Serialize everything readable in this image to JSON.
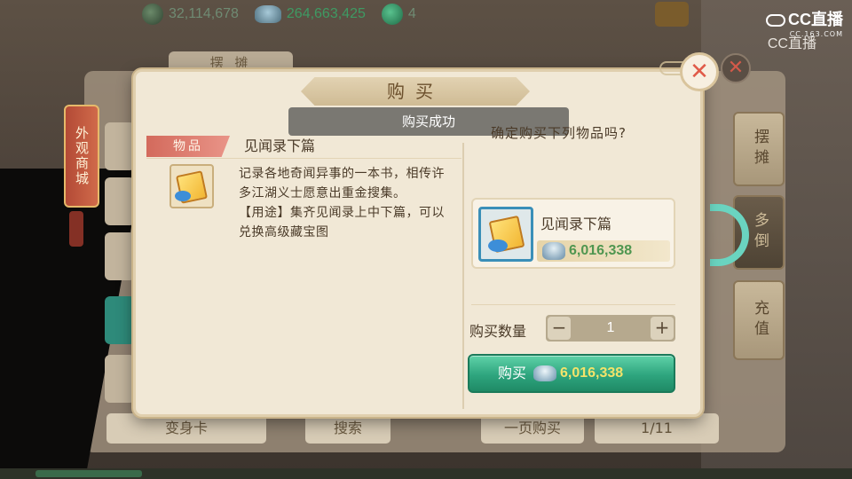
{
  "topbar": {
    "currencies": [
      {
        "icon": "coin-icon",
        "value": "32,114,678"
      },
      {
        "icon": "silver-ingot-icon",
        "value": "264,663,425"
      },
      {
        "icon": "jade-icon",
        "value": "4"
      }
    ]
  },
  "watermark": {
    "brand": "CC直播",
    "domain": "CC.163.COM",
    "brand2": "CC直播"
  },
  "background": {
    "stall_tab": "摆 摊",
    "left_tab": "外观商城",
    "right_tabs": [
      "摆摊",
      "多倒",
      "充值"
    ],
    "bottom_bar": {
      "item": "变身卡",
      "search": "搜索",
      "page_buy": "一页购买",
      "page": "1/11"
    }
  },
  "modal": {
    "title": "购买",
    "toast": "购买成功",
    "left": {
      "tag": "物品",
      "item_name": "见闻录下篇",
      "description": "记录各地奇闻异事的一本书，相传许多江湖义士愿意出重金搜集。\n【用途】集齐见闻录上中下篇，可以兑换高级藏宝图"
    },
    "right": {
      "confirm_text": "确定购买下列物品吗?",
      "product_name": "见闻录下篇",
      "price": "6,016,338",
      "quantity_label": "购买数量",
      "quantity": "1",
      "buy_label": "购买",
      "buy_price": "6,016,338"
    }
  },
  "colors": {
    "accent_green": "#2ea57e",
    "price_green": "#4f9650",
    "close_red": "#e05a48"
  }
}
